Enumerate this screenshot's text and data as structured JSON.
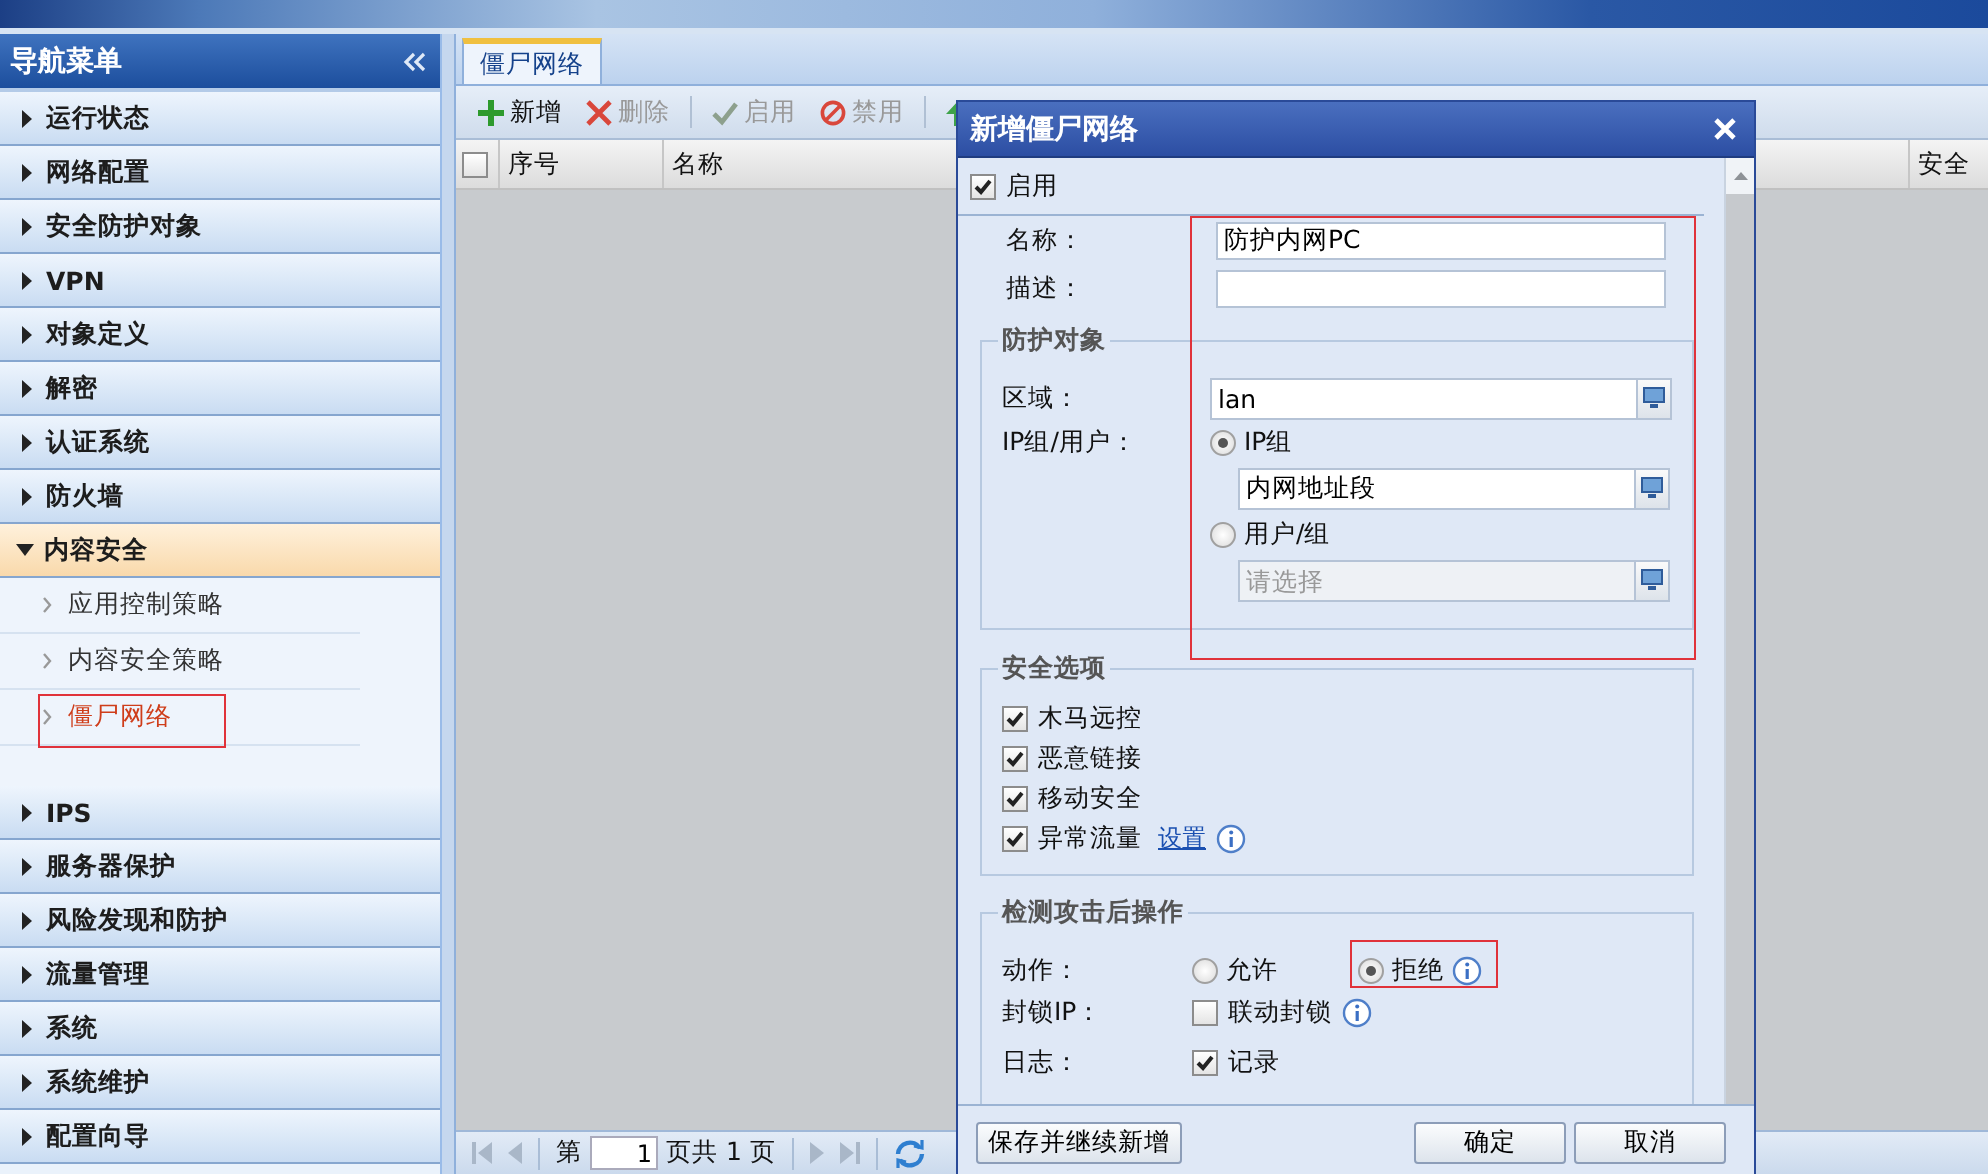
{
  "sidebar": {
    "title": "导航菜单",
    "items": [
      {
        "label": "运行状态",
        "expanded": false
      },
      {
        "label": "网络配置",
        "expanded": false
      },
      {
        "label": "安全防护对象",
        "expanded": false
      },
      {
        "label": "VPN",
        "expanded": false
      },
      {
        "label": "对象定义",
        "expanded": false
      },
      {
        "label": "解密",
        "expanded": false
      },
      {
        "label": "认证系统",
        "expanded": false
      },
      {
        "label": "防火墙",
        "expanded": false
      },
      {
        "label": "内容安全",
        "expanded": true,
        "children": [
          {
            "label": "应用控制策略",
            "selected": false
          },
          {
            "label": "内容安全策略",
            "selected": false
          },
          {
            "label": "僵尸网络",
            "selected": true
          }
        ]
      },
      {
        "label": "IPS",
        "expanded": false
      },
      {
        "label": "服务器保护",
        "expanded": false
      },
      {
        "label": "风险发现和防护",
        "expanded": false
      },
      {
        "label": "流量管理",
        "expanded": false
      },
      {
        "label": "系统",
        "expanded": false
      },
      {
        "label": "系统维护",
        "expanded": false
      },
      {
        "label": "配置向导",
        "expanded": false
      }
    ]
  },
  "tabs": [
    {
      "label": "僵尸网络",
      "selected": true
    }
  ],
  "toolbar": [
    {
      "kind": "plus",
      "label": "新增",
      "disabled": false
    },
    {
      "kind": "cross",
      "label": "删除",
      "disabled": true
    },
    {
      "kind": "check",
      "label": "启用",
      "disabled": true
    },
    {
      "kind": "ban",
      "label": "禁用",
      "disabled": true
    },
    {
      "kind": "up"
    }
  ],
  "grid": {
    "select_all": {
      "checked": false
    },
    "columns": [
      "序号",
      "名称",
      "安全"
    ]
  },
  "pager": {
    "before": "第",
    "page": "1",
    "after": "页共 1 页"
  },
  "dialog": {
    "title": "新增僵尸网络",
    "enabled": {
      "label": "启用",
      "checked": true
    },
    "fields": [
      {
        "label": "名称：",
        "value": "防护内网PC"
      },
      {
        "label": "描述："
      }
    ],
    "protected_object": {
      "legend": "防护对象",
      "zone": {
        "label": "区域：",
        "value": "lan"
      },
      "target_label": "IP组/用户：",
      "options": [
        {
          "label": "IP组",
          "selected": true,
          "value": "内网地址段"
        },
        {
          "label": "用户/组",
          "selected": false,
          "placeholder": "请选择"
        }
      ]
    },
    "security_options": {
      "legend": "安全选项",
      "items": [
        {
          "label": "木马远控",
          "checked": true
        },
        {
          "label": "恶意链接",
          "checked": true
        },
        {
          "label": "移动安全",
          "checked": true
        },
        {
          "label": "异常流量",
          "checked": true,
          "link": "设置",
          "info": true
        }
      ]
    },
    "after_detection": {
      "legend": "检测攻击后操作",
      "rows": [
        {
          "kind": "radio",
          "label": "动作：",
          "options": [
            {
              "label": "允许",
              "selected": false
            },
            {
              "label": "拒绝",
              "selected": true,
              "info": true
            }
          ]
        },
        {
          "kind": "checkbox",
          "label": "封锁IP：",
          "option": {
            "label": "联动封锁",
            "checked": false,
            "info": true
          }
        },
        {
          "kind": "checkbox",
          "label": "日志：",
          "option": {
            "label": "记录",
            "checked": true
          }
        }
      ]
    },
    "buttons": [
      {
        "label": "保存并继续新增",
        "kind": "left"
      },
      {
        "label": "确定",
        "kind": "right"
      },
      {
        "label": "取消",
        "kind": "right"
      }
    ]
  }
}
